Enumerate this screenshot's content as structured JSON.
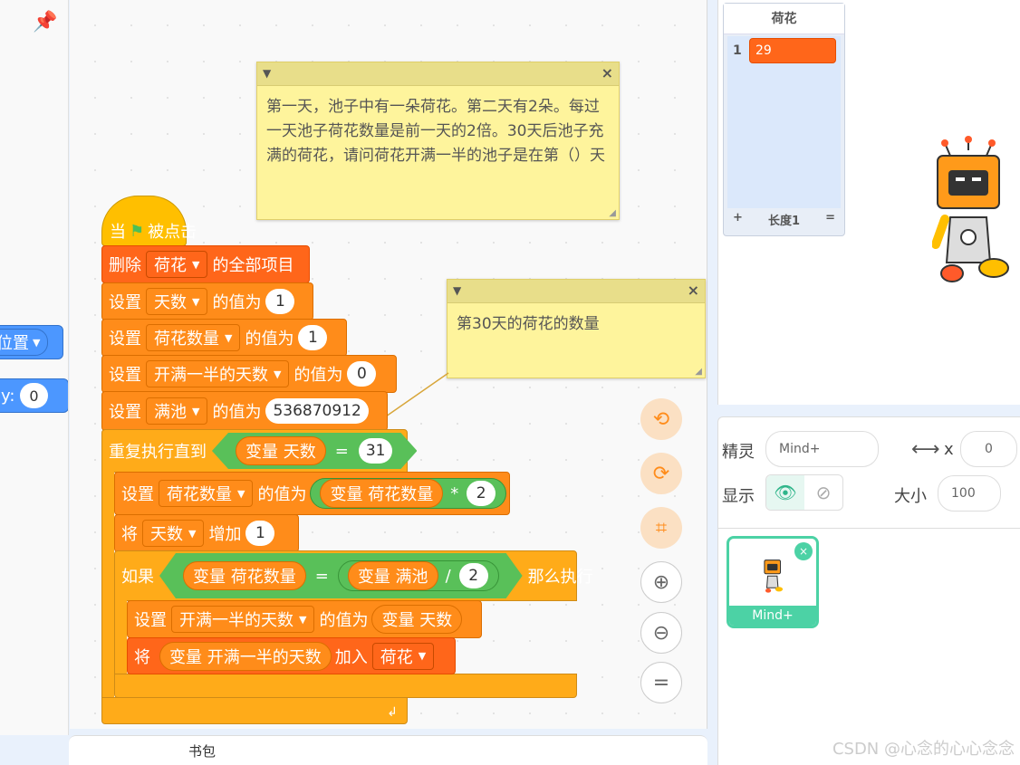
{
  "palette": {
    "position_label": "位置",
    "y_label": "y:",
    "y_value": "0"
  },
  "comments": [
    {
      "text": "第一天，池子中有一朵荷花。第二天有2朵。每过一天池子荷花数量是前一天的2倍。30天后池子充满的荷花，请问荷花开满一半的池子是在第（）天"
    },
    {
      "text": "第30天的荷花的数量"
    }
  ],
  "script": {
    "hat": {
      "when": "当",
      "clicked": "被点击"
    },
    "delete": {
      "label": "删除",
      "list": "荷花",
      "suffix": "的全部项目"
    },
    "set1": {
      "label": "设置",
      "var": "天数",
      "mid": "的值为",
      "value": "1"
    },
    "set2": {
      "label": "设置",
      "var": "荷花数量",
      "mid": "的值为",
      "value": "1"
    },
    "set3": {
      "label": "设置",
      "var": "开满一半的天数",
      "mid": "的值为",
      "value": "0"
    },
    "set4": {
      "label": "设置",
      "var": "满池",
      "mid": "的值为",
      "value": "536870912"
    },
    "repeat": {
      "label": "重复执行直到",
      "var": "变量 天数",
      "op": "=",
      "value": "31"
    },
    "set5": {
      "label": "设置",
      "var": "荷花数量",
      "mid": "的值为",
      "expr_var": "变量 荷花数量",
      "op": "*",
      "value": "2"
    },
    "change": {
      "label": "将",
      "var": "天数",
      "mid": "增加",
      "value": "1"
    },
    "if": {
      "label": "如果",
      "left": "变量 荷花数量",
      "op": "=",
      "right_var": "变量 满池",
      "div": "/",
      "value": "2",
      "then": "那么执行"
    },
    "set6": {
      "label": "设置",
      "var": "开满一半的天数",
      "mid": "的值为",
      "value_var": "变量 天数"
    },
    "add": {
      "label": "将",
      "var": "变量 开满一半的天数",
      "mid": "加入",
      "list": "荷花"
    }
  },
  "bottom": {
    "backpack": "书包"
  },
  "list_monitor": {
    "title": "荷花",
    "index": "1",
    "item": "29",
    "add": "+",
    "length": "长度1",
    "equals": "="
  },
  "sprite": {
    "sprite_label": "精灵",
    "sprite_name": "Mind+",
    "x_label": "x",
    "x_value": "0",
    "show_label": "显示",
    "size_label": "大小",
    "size_value": "100",
    "thumb_name": "Mind+"
  },
  "watermark": "CSDN @心念的心心念念"
}
